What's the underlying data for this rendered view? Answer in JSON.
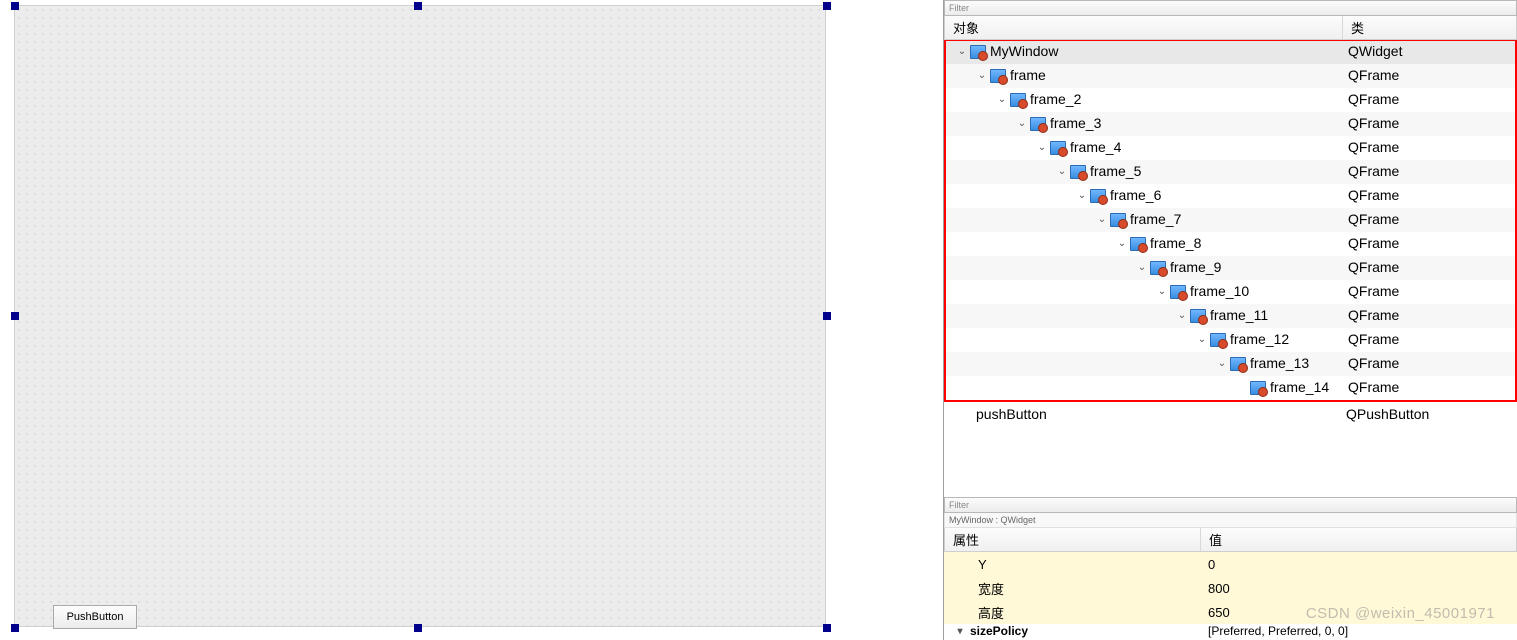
{
  "canvas": {
    "pushbutton_label": "PushButton"
  },
  "filter_label": "Filter",
  "obj_header": {
    "col1": "对象",
    "col2": "类"
  },
  "tree": [
    {
      "name": "MyWindow",
      "cls": "QWidget",
      "depth": 0,
      "sel": true
    },
    {
      "name": "frame",
      "cls": "QFrame",
      "depth": 1
    },
    {
      "name": "frame_2",
      "cls": "QFrame",
      "depth": 2
    },
    {
      "name": "frame_3",
      "cls": "QFrame",
      "depth": 3
    },
    {
      "name": "frame_4",
      "cls": "QFrame",
      "depth": 4
    },
    {
      "name": "frame_5",
      "cls": "QFrame",
      "depth": 5
    },
    {
      "name": "frame_6",
      "cls": "QFrame",
      "depth": 6
    },
    {
      "name": "frame_7",
      "cls": "QFrame",
      "depth": 7
    },
    {
      "name": "frame_8",
      "cls": "QFrame",
      "depth": 8
    },
    {
      "name": "frame_9",
      "cls": "QFrame",
      "depth": 9
    },
    {
      "name": "frame_10",
      "cls": "QFrame",
      "depth": 10
    },
    {
      "name": "frame_11",
      "cls": "QFrame",
      "depth": 11
    },
    {
      "name": "frame_12",
      "cls": "QFrame",
      "depth": 12
    },
    {
      "name": "frame_13",
      "cls": "QFrame",
      "depth": 13
    },
    {
      "name": "frame_14",
      "cls": "QFrame",
      "depth": 14,
      "leaf": true
    }
  ],
  "extra_row": {
    "name": "pushButton",
    "cls": "QPushButton"
  },
  "prop_context": "MyWindow : QWidget",
  "prop_header": {
    "col1": "属性",
    "col2": "值"
  },
  "props": [
    {
      "k": "Y",
      "v": "0",
      "yellow": true
    },
    {
      "k": "宽度",
      "v": "800",
      "yellow": true
    },
    {
      "k": "高度",
      "v": "650",
      "yellow": true
    }
  ],
  "prop_cut": {
    "k": "sizePolicy",
    "v": "[Preferred, Preferred, 0, 0]"
  },
  "watermark": "CSDN @weixin_45001971"
}
